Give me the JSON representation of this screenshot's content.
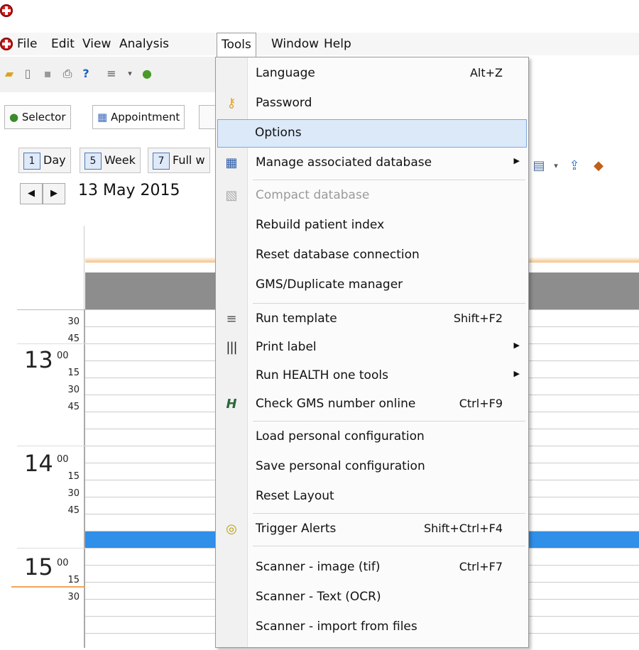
{
  "menubar": {
    "items": [
      "File",
      "Edit",
      "View",
      "Analysis",
      "Tools",
      "Window",
      "Help"
    ]
  },
  "tabs": {
    "selector": "Selector",
    "appointment": "Appointment"
  },
  "view_buttons": {
    "day_num": "1",
    "day": "Day",
    "week_num": "5",
    "week": "Week",
    "fullw_num": "7",
    "fullw": "Full w"
  },
  "date": "13 May 2015",
  "calendar": {
    "hours": [
      "13",
      "14",
      "15"
    ],
    "hour_sup": "00",
    "minute_labels": [
      "30",
      "45",
      "15",
      "30",
      "45",
      "15",
      "30",
      "45",
      "15",
      "30"
    ]
  },
  "tools_menu": {
    "items": [
      {
        "label": "Language",
        "shortcut": "Alt+Z",
        "icon": ""
      },
      {
        "label": "Password",
        "shortcut": "",
        "icon": "key-icon"
      },
      {
        "label": "Options",
        "shortcut": "",
        "icon": ""
      },
      {
        "label": "Manage associated database",
        "shortcut": "",
        "icon": "calendar-grid-icon",
        "submenu": true
      },
      {
        "label": "Compact database",
        "shortcut": "",
        "icon": "compact-icon",
        "disabled": true
      },
      {
        "label": "Rebuild patient index",
        "shortcut": "",
        "icon": ""
      },
      {
        "label": "Reset database connection",
        "shortcut": "",
        "icon": ""
      },
      {
        "label": "GMS/Duplicate manager",
        "shortcut": "",
        "icon": ""
      },
      {
        "label": "Run template",
        "shortcut": "Shift+F2",
        "icon": "template-icon"
      },
      {
        "label": "Print label",
        "shortcut": "",
        "icon": "barcode-icon",
        "submenu": true
      },
      {
        "label": "Run HEALTH one tools",
        "shortcut": "",
        "icon": "",
        "submenu": true
      },
      {
        "label": "Check GMS number online",
        "shortcut": "Ctrl+F9",
        "icon": "health-logo-icon"
      },
      {
        "label": "Load personal configuration",
        "shortcut": "",
        "icon": ""
      },
      {
        "label": "Save personal configuration",
        "shortcut": "",
        "icon": ""
      },
      {
        "label": "Reset Layout",
        "shortcut": "",
        "icon": ""
      },
      {
        "label": "Trigger Alerts",
        "shortcut": "Shift+Ctrl+F4",
        "icon": "alert-magnifier-icon"
      },
      {
        "label": "Scanner - image (tif)",
        "shortcut": "Ctrl+F7",
        "icon": ""
      },
      {
        "label": "Scanner - Text (OCR)",
        "shortcut": "",
        "icon": ""
      },
      {
        "label": "Scanner - import from files",
        "shortcut": "",
        "icon": ""
      }
    ]
  },
  "colors": {
    "selected_row": "#2f8fe9",
    "highlight": "#dbe9f9",
    "header_gray": "#8d8d8d"
  }
}
